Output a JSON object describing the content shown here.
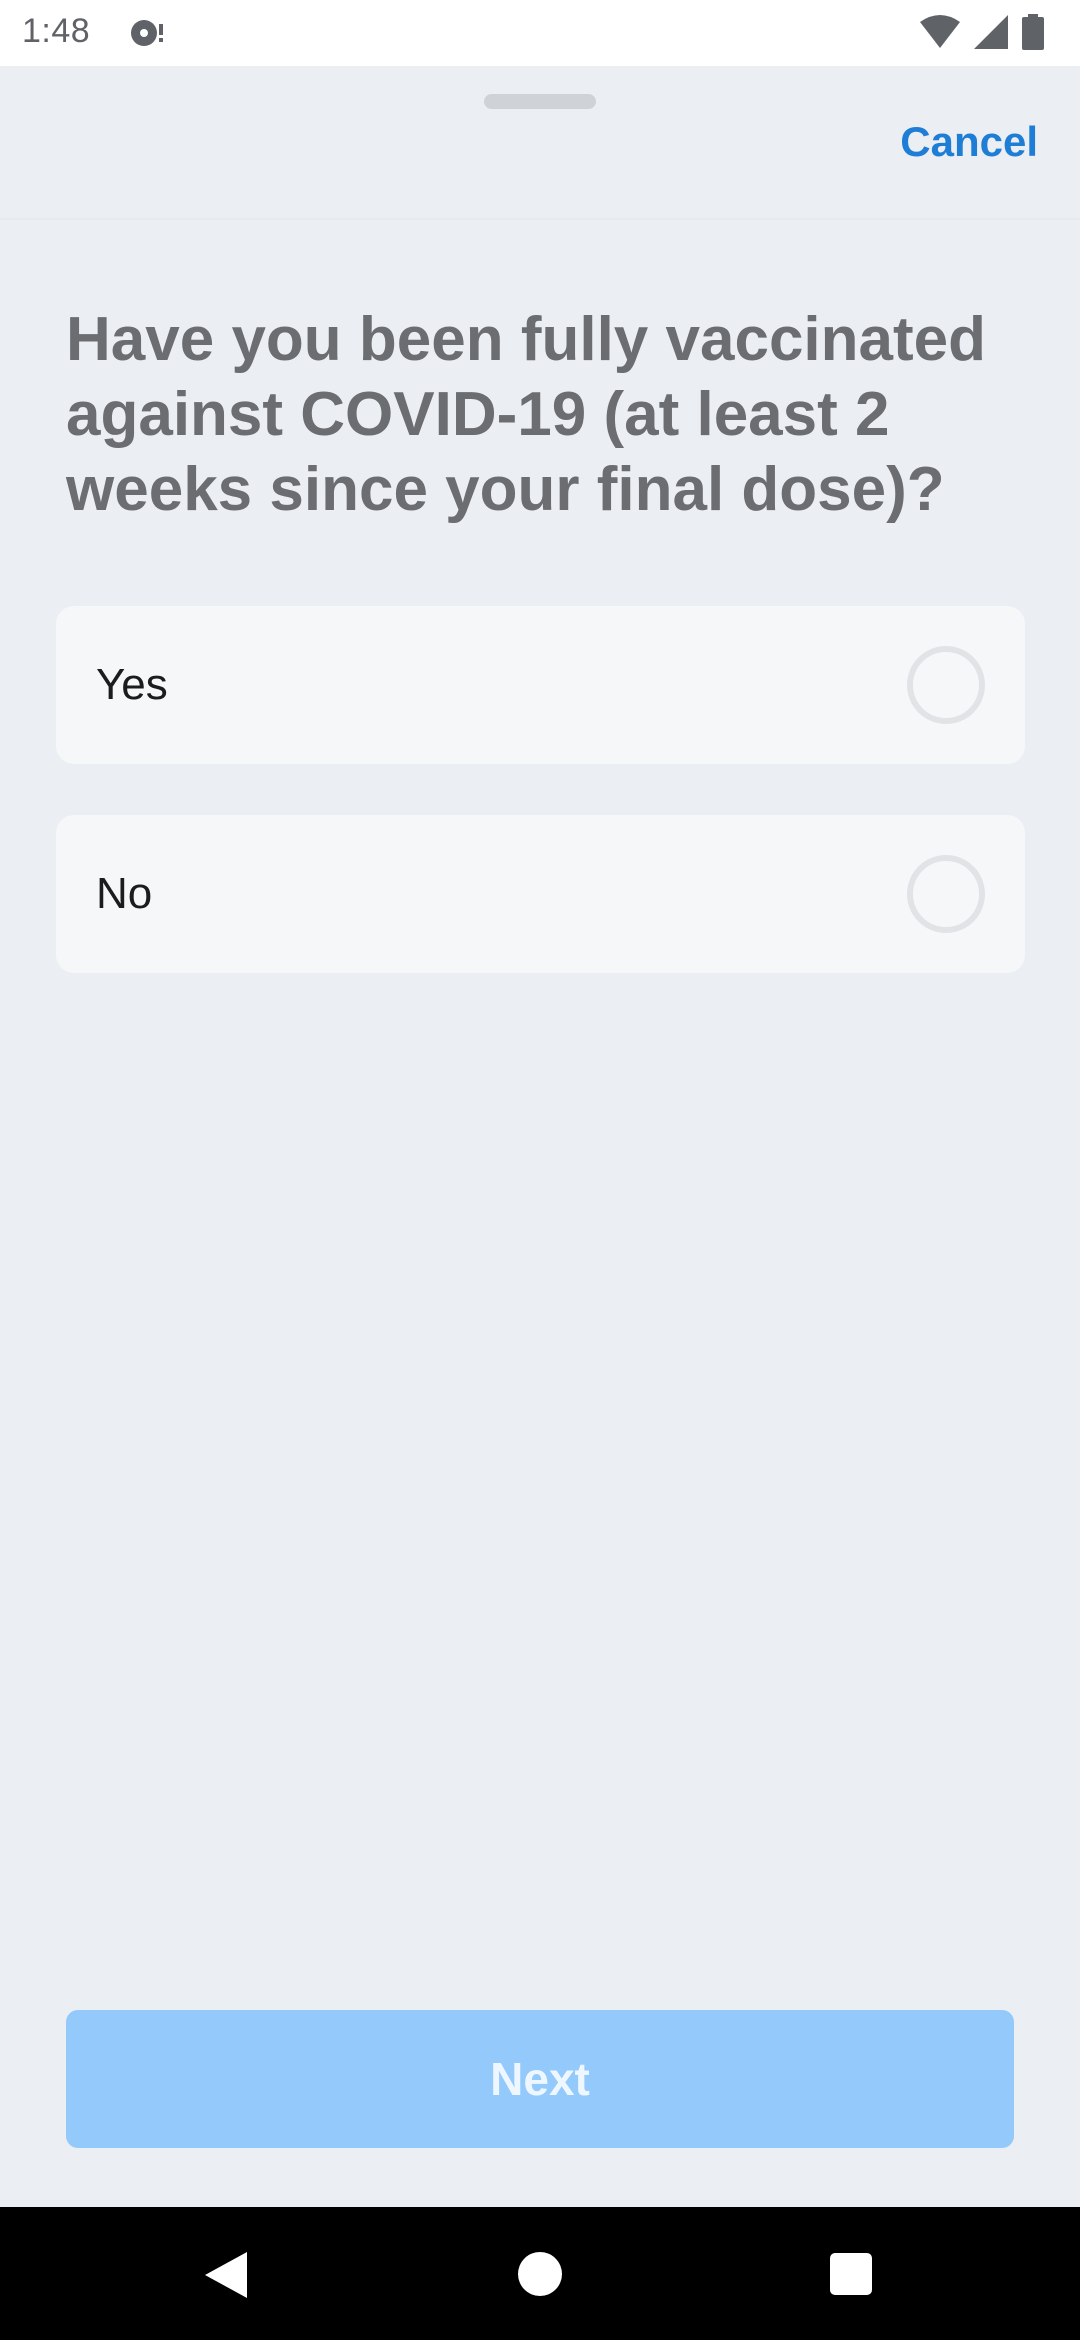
{
  "status_bar": {
    "time": "1:48",
    "icons": [
      "notification-icon",
      "wifi-icon",
      "cell-signal-icon",
      "battery-icon"
    ]
  },
  "header": {
    "cancel_label": "Cancel"
  },
  "question": {
    "text": "Have you been fully vaccinated against COVID-19 (at least 2 weeks since your final dose)?"
  },
  "options": [
    {
      "label": "Yes",
      "selected": false
    },
    {
      "label": "No",
      "selected": false
    }
  ],
  "footer": {
    "next_label": "Next",
    "next_enabled": false
  },
  "colors": {
    "accent": "#1e7ed6",
    "next_disabled": "#93c9fb",
    "sheet_background": "#ebeef3",
    "option_background": "#f6f7f9"
  },
  "nav_bar": {
    "icons": [
      "back-icon",
      "home-icon",
      "recents-icon"
    ]
  }
}
